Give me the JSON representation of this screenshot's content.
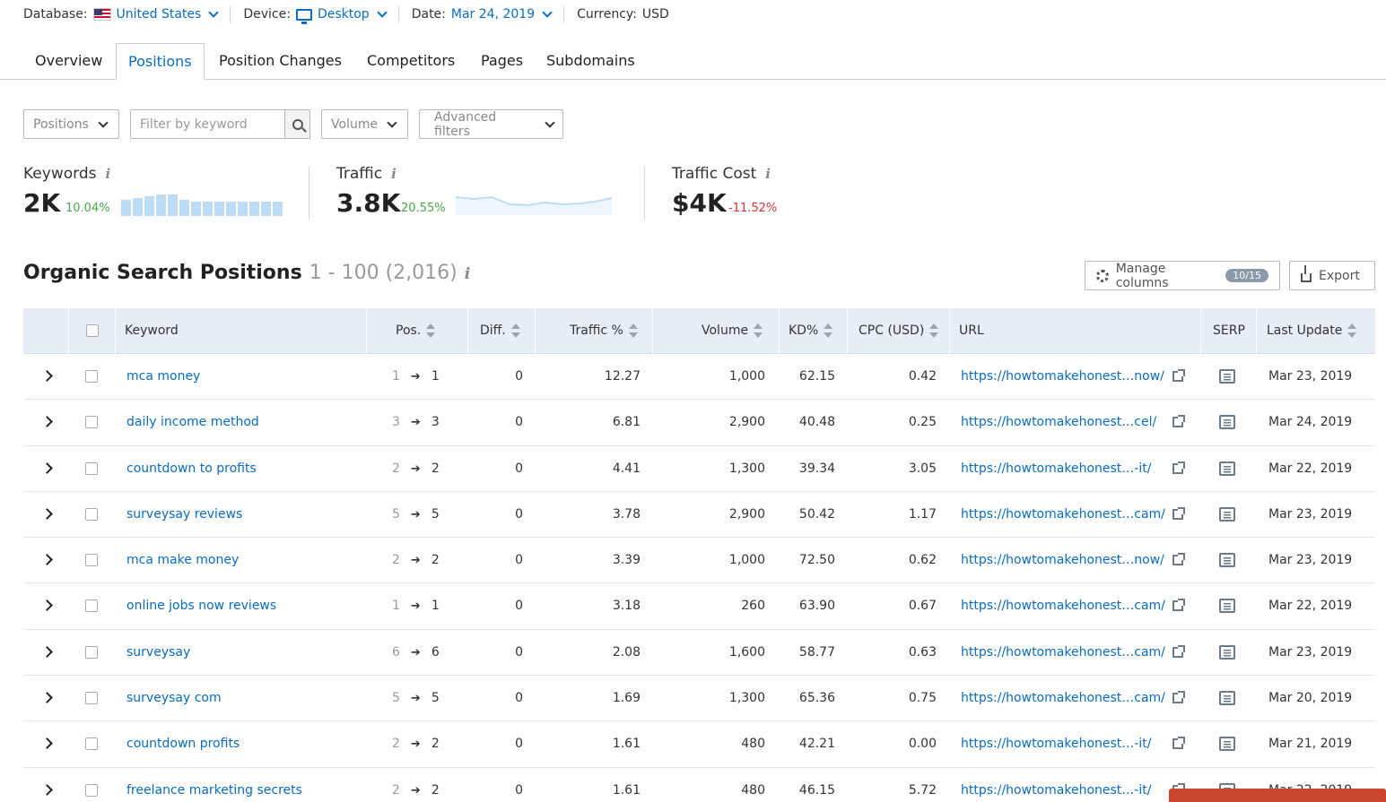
{
  "topbar": {
    "database_label": "Database:",
    "database_value": "United States",
    "device_label": "Device:",
    "device_value": "Desktop",
    "date_label": "Date:",
    "date_value": "Mar 24, 2019",
    "currency_label": "Currency:",
    "currency_value": "USD"
  },
  "tabs": [
    {
      "label": "Overview"
    },
    {
      "label": "Positions",
      "active": true
    },
    {
      "label": "Position Changes"
    },
    {
      "label": "Competitors"
    },
    {
      "label": "Pages"
    },
    {
      "label": "Subdomains"
    }
  ],
  "filters": {
    "positions": "Positions",
    "keyword_placeholder": "Filter by keyword",
    "volume": "Volume",
    "advanced": "Advanced filters"
  },
  "stats": {
    "keywords": {
      "label": "Keywords",
      "value": "2K",
      "change": "10.04%"
    },
    "traffic": {
      "label": "Traffic",
      "value": "3.8K",
      "change": "20.55%"
    },
    "traffic_cost": {
      "label": "Traffic Cost",
      "value": "$4K",
      "change": "-11.52%"
    }
  },
  "section": {
    "title": "Organic Search Positions",
    "range": "1 - 100 (2,016)",
    "manage_columns": "Manage columns",
    "columns_badge": "10/15",
    "export": "Export"
  },
  "table": {
    "headers": {
      "keyword": "Keyword",
      "pos": "Pos.",
      "diff": "Diff.",
      "traffic": "Traffic %",
      "volume": "Volume",
      "kd": "KD%",
      "cpc": "CPC (USD)",
      "url": "URL",
      "serp": "SERP",
      "last_update": "Last Update"
    },
    "rows": [
      {
        "keyword": "mca money",
        "pos_old": "1",
        "pos_new": "1",
        "diff": "0",
        "traffic": "12.27",
        "volume": "1,000",
        "kd": "62.15",
        "cpc": "0.42",
        "url": "https://howtomakehonest…now/",
        "updated": "Mar 23, 2019"
      },
      {
        "keyword": "daily income method",
        "pos_old": "3",
        "pos_new": "3",
        "diff": "0",
        "traffic": "6.81",
        "volume": "2,900",
        "kd": "40.48",
        "cpc": "0.25",
        "url": "https://howtomakehonest…cel/",
        "updated": "Mar 24, 2019"
      },
      {
        "keyword": "countdown to profits",
        "pos_old": "2",
        "pos_new": "2",
        "diff": "0",
        "traffic": "4.41",
        "volume": "1,300",
        "kd": "39.34",
        "cpc": "3.05",
        "url": "https://howtomakehonest…-it/",
        "updated": "Mar 22, 2019"
      },
      {
        "keyword": "surveysay reviews",
        "pos_old": "5",
        "pos_new": "5",
        "diff": "0",
        "traffic": "3.78",
        "volume": "2,900",
        "kd": "50.42",
        "cpc": "1.17",
        "url": "https://howtomakehonest…cam/",
        "updated": "Mar 23, 2019"
      },
      {
        "keyword": "mca make money",
        "pos_old": "2",
        "pos_new": "2",
        "diff": "0",
        "traffic": "3.39",
        "volume": "1,000",
        "kd": "72.50",
        "cpc": "0.62",
        "url": "https://howtomakehonest…now/",
        "updated": "Mar 23, 2019"
      },
      {
        "keyword": "online jobs now reviews",
        "pos_old": "1",
        "pos_new": "1",
        "diff": "0",
        "traffic": "3.18",
        "volume": "260",
        "kd": "63.90",
        "cpc": "0.67",
        "url": "https://howtomakehonest…cam/",
        "updated": "Mar 22, 2019"
      },
      {
        "keyword": "surveysay",
        "pos_old": "6",
        "pos_new": "6",
        "diff": "0",
        "traffic": "2.08",
        "volume": "1,600",
        "kd": "58.77",
        "cpc": "0.63",
        "url": "https://howtomakehonest…cam/",
        "updated": "Mar 23, 2019"
      },
      {
        "keyword": "surveysay com",
        "pos_old": "5",
        "pos_new": "5",
        "diff": "0",
        "traffic": "1.69",
        "volume": "1,300",
        "kd": "65.36",
        "cpc": "0.75",
        "url": "https://howtomakehonest…cam/",
        "updated": "Mar 20, 2019"
      },
      {
        "keyword": "countdown profits",
        "pos_old": "2",
        "pos_new": "2",
        "diff": "0",
        "traffic": "1.61",
        "volume": "480",
        "kd": "42.21",
        "cpc": "0.00",
        "url": "https://howtomakehonest…-it/",
        "updated": "Mar 21, 2019"
      },
      {
        "keyword": "freelance marketing secrets",
        "pos_old": "2",
        "pos_new": "2",
        "diff": "0",
        "traffic": "1.61",
        "volume": "480",
        "kd": "46.15",
        "cpc": "5.72",
        "url": "https://howtomakehonest…-it/",
        "updated": "Mar 22, 2019"
      }
    ]
  },
  "colors": {
    "link": "#0a6cc2",
    "positive": "#4aa84a",
    "negative": "#d9352e",
    "header_bg": "#e8eef5"
  }
}
